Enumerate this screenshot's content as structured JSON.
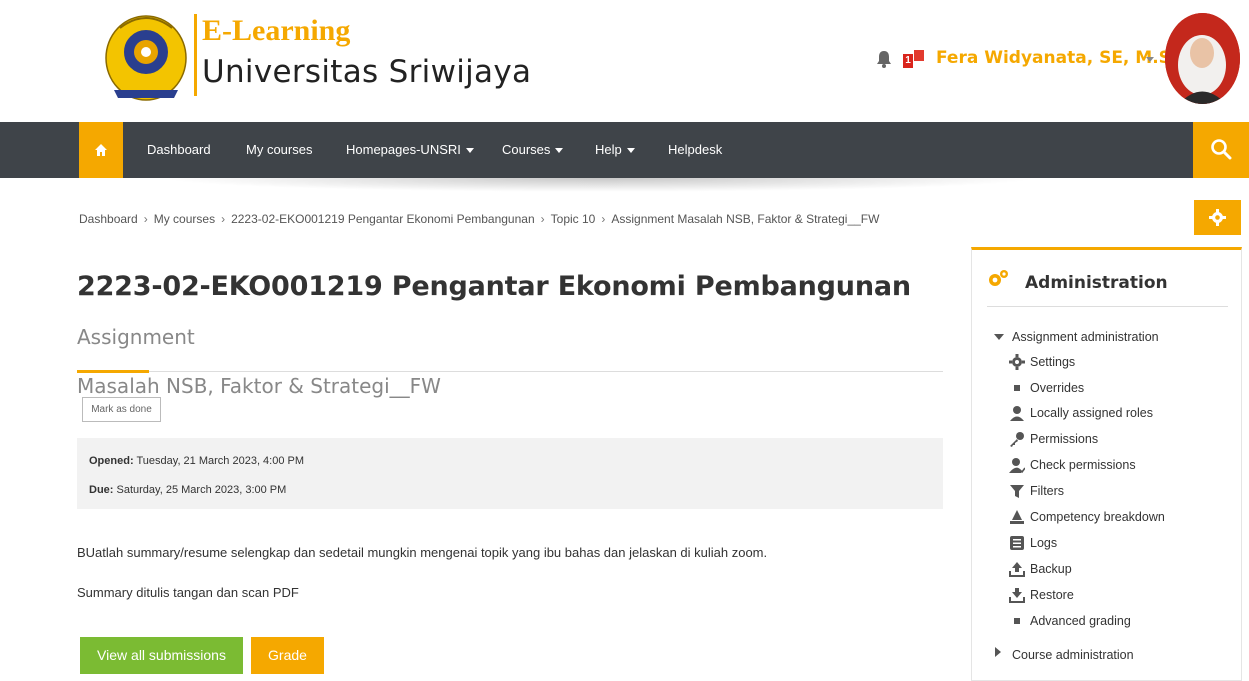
{
  "brand": {
    "title": "E-Learning",
    "subtitle": "Universitas  Sriwijaya"
  },
  "header": {
    "notification_count": "1",
    "user_name": "Fera Widyanata, SE, M.Si"
  },
  "navbar": {
    "items": [
      {
        "label": "Dashboard"
      },
      {
        "label": "My courses"
      },
      {
        "label": "Homepages-UNSRI"
      },
      {
        "label": "Courses"
      },
      {
        "label": "Help"
      },
      {
        "label": "Helpdesk"
      }
    ]
  },
  "breadcrumb": [
    "Dashboard",
    "My courses",
    "2223-02-EKO001219 Pengantar Ekonomi Pembangunan",
    "Topic 10",
    "Assignment Masalah NSB, Faktor & Strategi__FW"
  ],
  "page": {
    "course_title": "2223-02-EKO001219 Pengantar Ekonomi Pembangunan",
    "activity_part1": "Assignment",
    "activity_part2": "Masalah NSB, Faktor & Strategi__FW",
    "mark_done": "Mark as done",
    "opened_label": "Opened:",
    "opened_value": "Tuesday, 21 March 2023, 4:00 PM",
    "due_label": "Due:",
    "due_value": "Saturday, 25 March 2023, 3:00 PM",
    "description_1": "BUatlah summary/resume selengkap dan sedetail mungkin mengenai topik yang  ibu bahas dan jelaskan di kuliah zoom.",
    "description_2": "Summary ditulis tangan dan scan PDF",
    "view_all_button": "View all submissions",
    "grade_button": "Grade"
  },
  "admin": {
    "title": "Administration",
    "assignment_admin": "Assignment administration",
    "items": [
      {
        "label": "Settings",
        "icon": "gear-icon"
      },
      {
        "label": "Overrides",
        "icon": "bullet-icon"
      },
      {
        "label": "Locally assigned roles",
        "icon": "user-icon"
      },
      {
        "label": "Permissions",
        "icon": "key-icon"
      },
      {
        "label": "Check permissions",
        "icon": "user-check-icon"
      },
      {
        "label": "Filters",
        "icon": "filter-icon"
      },
      {
        "label": "Competency breakdown",
        "icon": "competency-icon"
      },
      {
        "label": "Logs",
        "icon": "logs-icon"
      },
      {
        "label": "Backup",
        "icon": "upload-icon"
      },
      {
        "label": "Restore",
        "icon": "download-icon"
      },
      {
        "label": "Advanced grading",
        "icon": "bullet-icon"
      }
    ],
    "course_admin": "Course administration"
  },
  "colors": {
    "accent": "#f5a800",
    "navbar": "#3f4449",
    "green": "#7bbb33"
  }
}
